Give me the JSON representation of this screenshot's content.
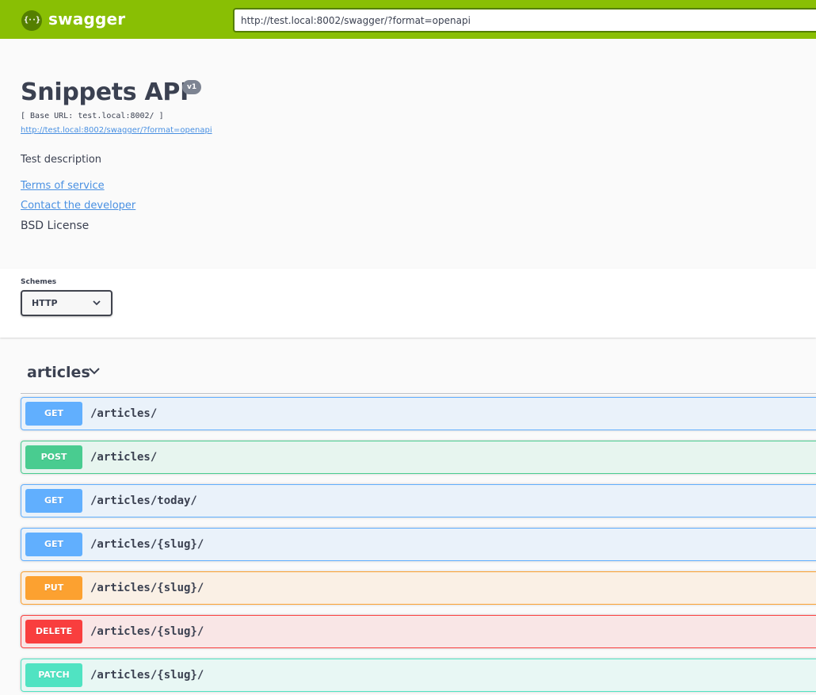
{
  "topbar": {
    "logo_glyph": "{··}",
    "brand": "swagger",
    "url_value": "http://test.local:8002/swagger/?format=openapi",
    "accent": "#89bf04"
  },
  "info": {
    "title": "Snippets API",
    "version": "v1",
    "base_url": "[ Base URL: test.local:8002/ ]",
    "spec_link": "http://test.local:8002/swagger/?format=openapi",
    "description": "Test description",
    "terms_of_service": "Terms of service",
    "contact": "Contact the developer",
    "license": "BSD License"
  },
  "schemes": {
    "label": "Schemes",
    "selected": "HTTP"
  },
  "tag": {
    "name": "articles"
  },
  "operations": [
    {
      "method": "GET",
      "path": "/articles/",
      "color": "#61affe"
    },
    {
      "method": "POST",
      "path": "/articles/",
      "color": "#49cc90"
    },
    {
      "method": "GET",
      "path": "/articles/today/",
      "color": "#61affe"
    },
    {
      "method": "GET",
      "path": "/articles/{slug}/",
      "color": "#61affe"
    },
    {
      "method": "PUT",
      "path": "/articles/{slug}/",
      "color": "#fca130"
    },
    {
      "method": "DELETE",
      "path": "/articles/{slug}/",
      "color": "#f93e3e"
    },
    {
      "method": "PATCH",
      "path": "/articles/{slug}/",
      "color": "#50e3c2"
    }
  ]
}
